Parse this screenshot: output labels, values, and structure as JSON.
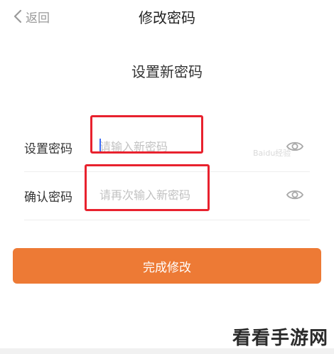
{
  "nav": {
    "back_icon": "chevron-left-icon",
    "back_label": "返回",
    "title": "修改密码"
  },
  "section_heading": "设置新密码",
  "form": {
    "new_password": {
      "label": "设置密码",
      "placeholder": "请输入新密码",
      "visibility_icon": "eye-icon"
    },
    "confirm_password": {
      "label": "确认密码",
      "placeholder": "请再次输入新密码",
      "visibility_icon": "eye-icon"
    }
  },
  "submit_label": "完成修改",
  "colors": {
    "accent": "#ed7a35",
    "highlight": "#e8222e",
    "caret": "#3b6cf6"
  },
  "watermark": {
    "text": "看看手游网",
    "faint": "Baidu经验"
  }
}
